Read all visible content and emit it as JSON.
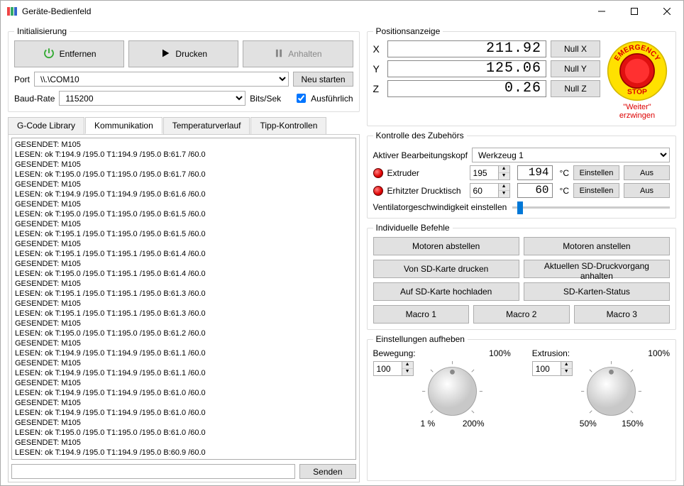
{
  "window": {
    "title": "Geräte-Bedienfeld"
  },
  "init": {
    "legend": "Initialisierung",
    "remove": "Entfernen",
    "print": "Drucken",
    "pause": "Anhalten",
    "port_label": "Port",
    "port_value": "\\\\.\\COM10",
    "restart": "Neu starten",
    "baud_label": "Baud-Rate",
    "baud_value": "115200",
    "baud_unit": "Bits/Sek",
    "verbose": "Ausführlich"
  },
  "tabs": {
    "gcode": "G-Code Library",
    "comm": "Kommunikation",
    "temp": "Temperaturverlauf",
    "jog": "Tipp-Kontrollen"
  },
  "log_lines": [
    "GESENDET: M105",
    "LESEN: ok T:194.9 /195.0 T1:194.9 /195.0 B:61.7 /60.0",
    "GESENDET: M105",
    "LESEN: ok T:195.0 /195.0 T1:195.0 /195.0 B:61.7 /60.0",
    "GESENDET: M105",
    "LESEN: ok T:194.9 /195.0 T1:194.9 /195.0 B:61.6 /60.0",
    "GESENDET: M105",
    "LESEN: ok T:195.0 /195.0 T1:195.0 /195.0 B:61.5 /60.0",
    "GESENDET: M105",
    "LESEN: ok T:195.1 /195.0 T1:195.0 /195.0 B:61.5 /60.0",
    "GESENDET: M105",
    "LESEN: ok T:195.1 /195.0 T1:195.1 /195.0 B:61.4 /60.0",
    "GESENDET: M105",
    "LESEN: ok T:195.0 /195.0 T1:195.1 /195.0 B:61.4 /60.0",
    "GESENDET: M105",
    "LESEN: ok T:195.1 /195.0 T1:195.1 /195.0 B:61.3 /60.0",
    "GESENDET: M105",
    "LESEN: ok T:195.1 /195.0 T1:195.1 /195.0 B:61.3 /60.0",
    "GESENDET: M105",
    "LESEN: ok T:195.0 /195.0 T1:195.0 /195.0 B:61.2 /60.0",
    "GESENDET: M105",
    "LESEN: ok T:194.9 /195.0 T1:194.9 /195.0 B:61.1 /60.0",
    "GESENDET: M105",
    "LESEN: ok T:194.9 /195.0 T1:194.9 /195.0 B:61.1 /60.0",
    "GESENDET: M105",
    "LESEN: ok T:194.9 /195.0 T1:194.9 /195.0 B:61.0 /60.0",
    "GESENDET: M105",
    "LESEN: ok T:194.9 /195.0 T1:194.9 /195.0 B:61.0 /60.0",
    "GESENDET: M105",
    "LESEN: ok T:195.0 /195.0 T1:195.0 /195.0 B:61.0 /60.0",
    "GESENDET: M105",
    "LESEN: ok T:194.9 /195.0 T1:194.9 /195.0 B:60.9 /60.0"
  ],
  "send": "Senden",
  "position": {
    "legend": "Positionsanzeige",
    "x": "211.92",
    "y": "125.06",
    "z": "0.26",
    "null_x": "Null X",
    "null_y": "Null Y",
    "null_z": "Null Z",
    "force": "\"Weiter\" erzwingen"
  },
  "accessories": {
    "legend": "Kontrolle des Zubehörs",
    "head_label": "Aktiver Bearbeitungskopf",
    "head_value": "Werkzeug 1",
    "extruder": "Extruder",
    "extruder_set": "195",
    "extruder_actual": "194",
    "bed": "Erhitzter Drucktisch",
    "bed_set": "60",
    "bed_actual": "60",
    "unit": "°C",
    "set_btn": "Einstellen",
    "off_btn": "Aus",
    "fan_label": "Ventilatorgeschwindigkeit einstellen"
  },
  "commands": {
    "legend": "Individuelle Befehle",
    "motors_off": "Motoren abstellen",
    "motors_on": "Motoren anstellen",
    "sd_print": "Von SD-Karte drucken",
    "sd_pause": "Aktuellen SD-Druckvorgang anhalten",
    "sd_upload": "Auf SD-Karte hochladen",
    "sd_status": "SD-Karten-Status",
    "macro1": "Macro 1",
    "macro2": "Macro 2",
    "macro3": "Macro 3"
  },
  "overrides": {
    "legend": "Einstellungen aufheben",
    "movement": "Bewegung:",
    "movement_pct": "100%",
    "movement_val": "100",
    "movement_min": "1 %",
    "movement_max": "200%",
    "extrusion": "Extrusion:",
    "extrusion_pct": "100%",
    "extrusion_val": "100",
    "extrusion_min": "50%",
    "extrusion_max": "150%"
  }
}
